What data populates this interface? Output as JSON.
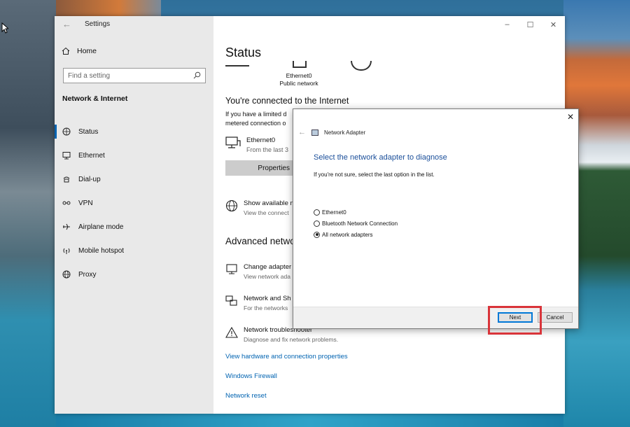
{
  "settings": {
    "app_title": "Settings",
    "home_label": "Home",
    "search_placeholder": "Find a setting",
    "section_title": "Network & Internet",
    "nav": [
      {
        "label": "Status",
        "icon": "status-icon"
      },
      {
        "label": "Ethernet",
        "icon": "ethernet-icon"
      },
      {
        "label": "Dial-up",
        "icon": "dial-up-icon"
      },
      {
        "label": "VPN",
        "icon": "vpn-icon"
      },
      {
        "label": "Airplane mode",
        "icon": "airplane-icon"
      },
      {
        "label": "Mobile hotspot",
        "icon": "hotspot-icon"
      },
      {
        "label": "Proxy",
        "icon": "proxy-icon"
      }
    ],
    "active_nav": "Status"
  },
  "status_page": {
    "title": "Status",
    "diagram_label_1": "Ethernet0",
    "diagram_label_2": "Public network",
    "connected_heading": "You're connected to the Internet",
    "connected_text_1": "If you have a limited d",
    "connected_text_2": "metered connection o",
    "adapter_name": "Ethernet0",
    "adapter_sub": "From the last 3",
    "properties_label": "Properties",
    "show_available_title": "Show available n",
    "show_available_sub": "View the connect",
    "advanced_heading": "Advanced network settings",
    "change_adapter_title": "Change adapter",
    "change_adapter_sub": "View network ada",
    "network_sharing_title": "Network and Sh",
    "network_sharing_sub": "For the networks",
    "troubleshooter_title": "Network troubleshooter",
    "troubleshooter_sub": "Diagnose and fix network problems.",
    "link_hw": "View hardware and connection properties",
    "link_firewall": "Windows Firewall",
    "link_reset": "Network reset"
  },
  "dialog": {
    "title": "Network Adapter",
    "heading": "Select the network adapter to diagnose",
    "instruction": "If you're not sure, select the last option in the list.",
    "options": [
      "Ethernet0",
      "Bluetooth Network Connection",
      "All network adapters"
    ],
    "selected_index": 2,
    "next_label": "Next",
    "cancel_label": "Cancel"
  },
  "colors": {
    "accent": "#0063b1",
    "heading_blue": "#1b4f9a",
    "highlight": "#d9343a"
  }
}
